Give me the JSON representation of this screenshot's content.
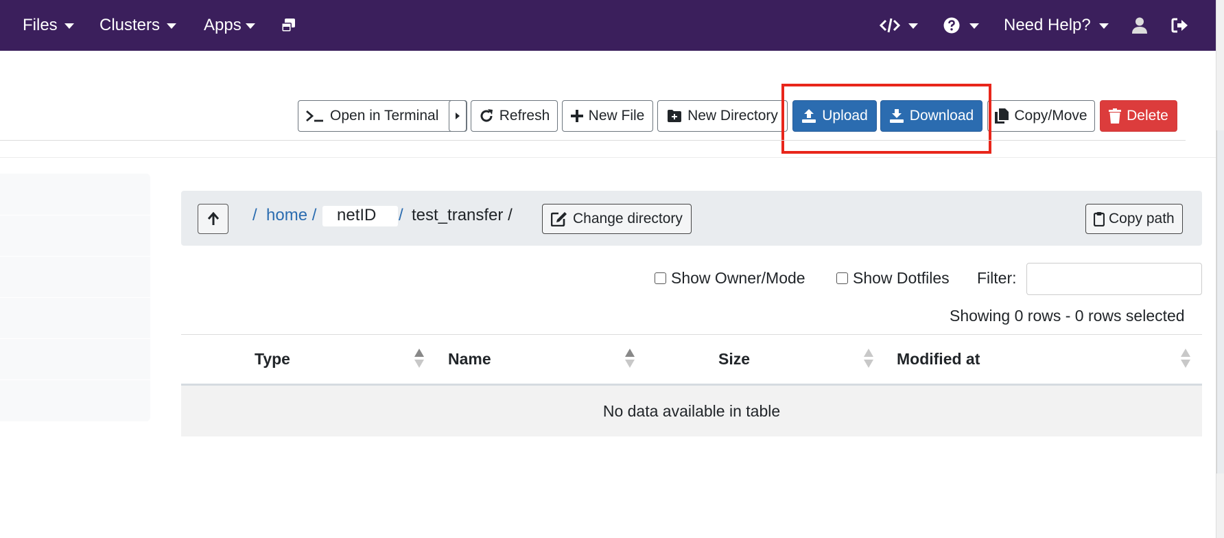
{
  "nav": {
    "files": "Files",
    "clusters": "Clusters",
    "apps": "Apps",
    "need_help": "Need Help?",
    "icons": [
      "windows-icon",
      "code-icon",
      "question-circle-icon",
      "user-icon",
      "sign-out-icon"
    ]
  },
  "toolbar": {
    "open_terminal": "Open in Terminal",
    "refresh": "Refresh",
    "new_file": "New File",
    "new_directory": "New Directory",
    "upload": "Upload",
    "download": "Download",
    "copy_move": "Copy/Move",
    "delete": "Delete"
  },
  "breadcrumb": {
    "sep": "/",
    "home": "home /",
    "netid": "netID",
    "sep2": "/",
    "current": "test_transfer /",
    "change_directory": "Change directory",
    "copy_path": "Copy path"
  },
  "options": {
    "show_owner_mode": "Show Owner/Mode",
    "show_dotfiles": "Show Dotfiles",
    "filter_label": "Filter:",
    "filter_value": "",
    "showing": "Showing 0 rows - 0 rows selected"
  },
  "table": {
    "columns": [
      "Type",
      "Name",
      "Size",
      "Modified at"
    ],
    "empty": "No data available in table"
  },
  "colors": {
    "navbar": "#3b1f5c",
    "primary": "#2b6cb0",
    "danger": "#dc3c3c",
    "highlight": "#e8261b"
  }
}
